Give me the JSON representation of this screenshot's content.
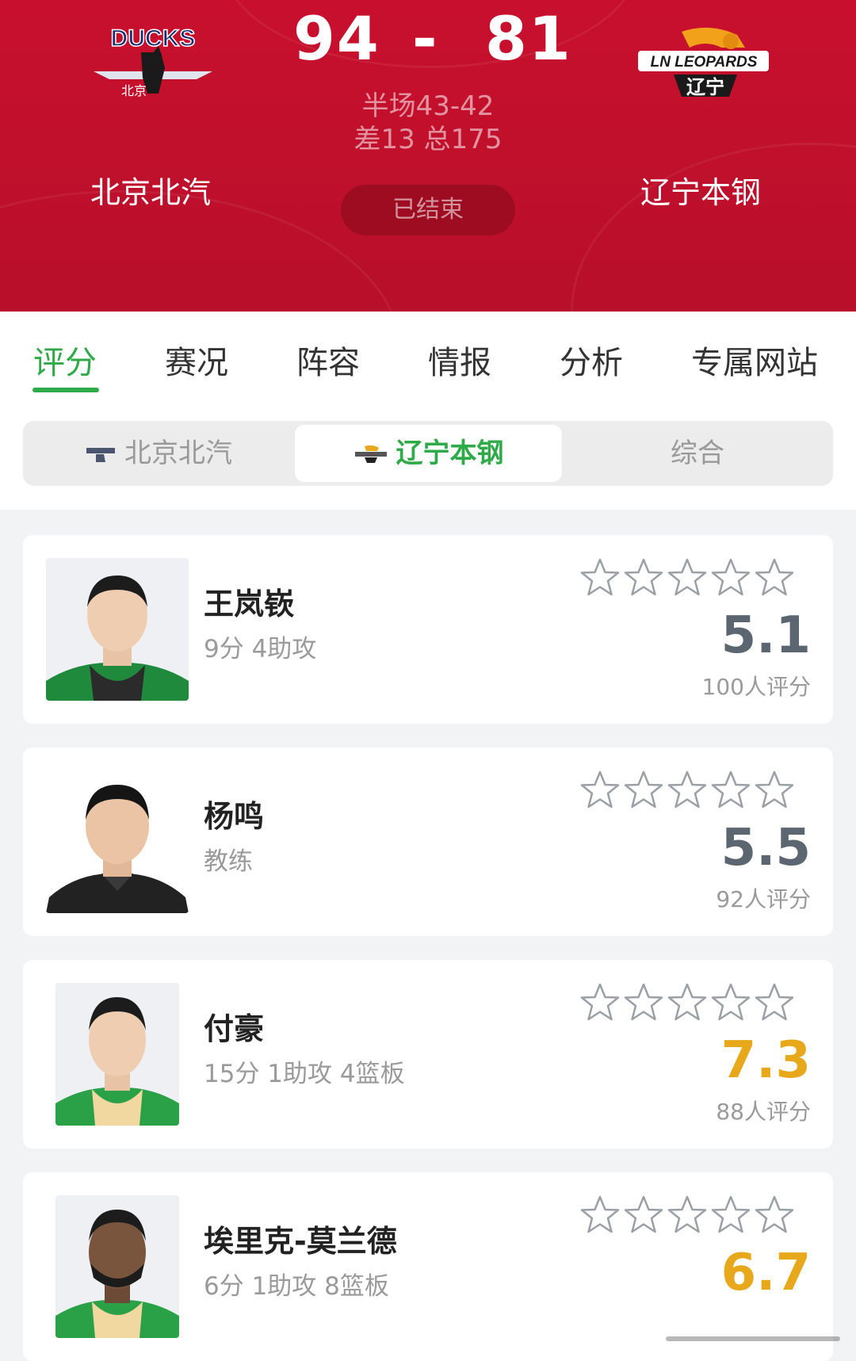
{
  "header": {
    "home_score": "94",
    "dash": "-",
    "away_score": "81",
    "half_score": "半场43-42",
    "diff_total": "差13 总175",
    "home_team": "北京北汽",
    "away_team": "辽宁本钢",
    "status": "已结束",
    "home_logo_text": "DUCKS",
    "home_logo_sub": "北京",
    "away_logo_text": "LN LEOPARDS",
    "away_logo_sub": "辽宁"
  },
  "tabs": [
    {
      "label": "评分",
      "active": true
    },
    {
      "label": "赛况"
    },
    {
      "label": "阵容"
    },
    {
      "label": "情报"
    },
    {
      "label": "分析"
    },
    {
      "label": "专属网站"
    }
  ],
  "segment": [
    {
      "label": "北京北汽"
    },
    {
      "label": "辽宁本钢",
      "active": true
    },
    {
      "label": "综合"
    }
  ],
  "players": [
    {
      "name": "王岚嵚",
      "stat": "9分 4助攻",
      "rating": "5.1",
      "count": "100人评分",
      "rating_color": "#5c6670",
      "jersey": "#1f8a3c"
    },
    {
      "name": "杨鸣",
      "stat": "教练",
      "rating": "5.5",
      "count": "92人评分",
      "rating_color": "#5c6670",
      "jersey": "#222222"
    },
    {
      "name": "付豪",
      "stat": "15分 1助攻 4篮板",
      "rating": "7.3",
      "count": "88人评分",
      "rating_color": "#e8a81c",
      "jersey": "#2aa146"
    },
    {
      "name": "埃里克-莫兰德",
      "stat": "6分 1助攻 8篮板",
      "rating": "6.7",
      "count": "",
      "rating_color": "#e8a81c",
      "jersey": "#2aa146"
    }
  ],
  "colors": {
    "header_red": "#c8102e",
    "accent_green": "#2eaa49",
    "rating_gold": "#e8a81c",
    "rating_gray": "#5c6670"
  }
}
